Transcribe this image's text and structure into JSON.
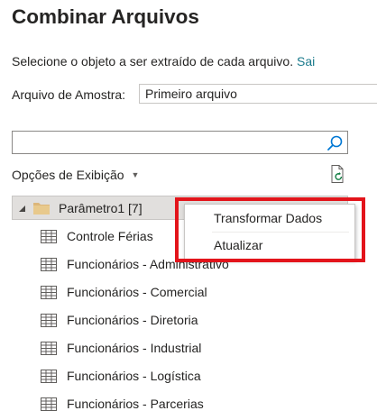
{
  "dialog": {
    "title": "Combinar Arquivos",
    "instruction": "Selecione o objeto a ser extraído de cada arquivo.",
    "instruction_link": "Sai"
  },
  "sample": {
    "label": "Arquivo de Amostra:",
    "selected": "Primeiro arquivo"
  },
  "search": {
    "value": "",
    "placeholder": ""
  },
  "view_options": {
    "label": "Opções de Exibição"
  },
  "tree": {
    "root_label": "Parâmetro1 [7]",
    "items": [
      "Controle Férias",
      "Funcionários - Administrativo",
      "Funcionários - Comercial",
      "Funcionários - Diretoria",
      "Funcionários - Industrial",
      "Funcionários - Logística",
      "Funcionários - Parcerias"
    ]
  },
  "context_menu": {
    "items": [
      "Transformar Dados",
      "Atualizar"
    ]
  },
  "colors": {
    "highlight": "#e3141b",
    "link": "#1a7a8c",
    "selected_row": "#e1dfdd",
    "icon_blue": "#0078d4",
    "folder": "#dcb67a"
  },
  "icons": [
    "search-icon",
    "refresh-icon",
    "expand-arrow-icon",
    "folder-icon",
    "table-icon"
  ]
}
